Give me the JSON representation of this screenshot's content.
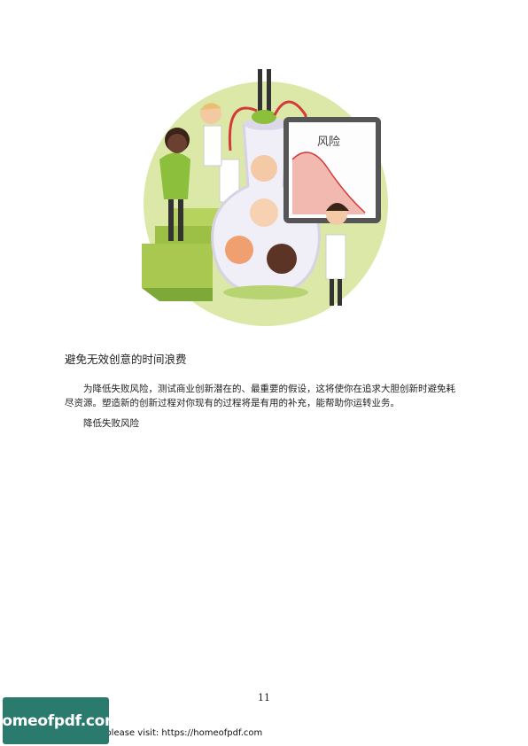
{
  "illustration": {
    "chart_label": "风险",
    "icon": "science-flask-risk-illustration"
  },
  "section": {
    "heading": "避免无效创意的时间浪费",
    "paragraph": "为降低失败风险，测试商业创新潜在的、最重要的假设，这将使你在追求大胆创新时避免耗尽资源。塑造新的创新过程对你现有的过程将是有用的补充，能帮助你运转业务。",
    "subtext": "降低失败风险"
  },
  "footer": {
    "page_number": "11",
    "visit_text": "e please visit: https://homeofpdf.com",
    "logo_text": "homeofpdf.com"
  },
  "colors": {
    "logo_bg": "#2a7a6d",
    "circle_bg": "#dce8a8",
    "chart_fill": "#f2b9b0"
  }
}
